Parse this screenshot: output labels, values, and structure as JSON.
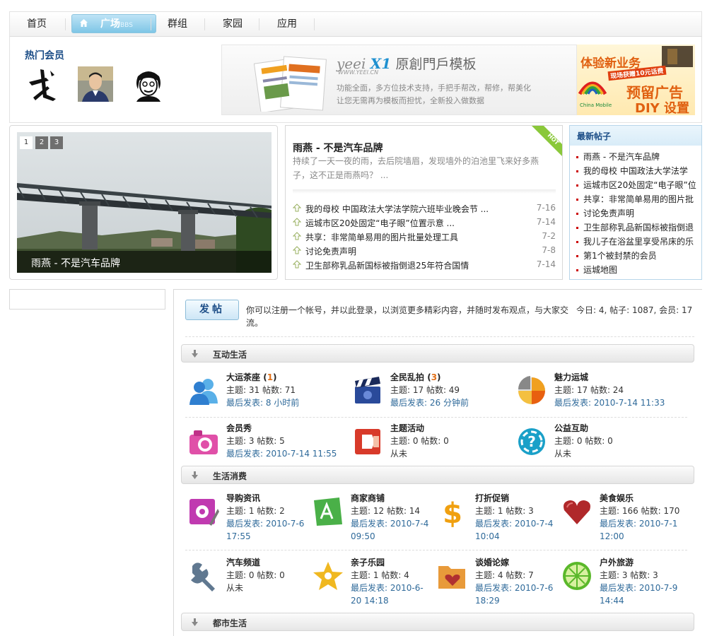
{
  "nav": {
    "home": "首页",
    "plaza": "广场",
    "plaza_sub": "BBS",
    "group": "群组",
    "home2": "家园",
    "apps": "应用"
  },
  "hot_members": {
    "title": "热门会员"
  },
  "banner1": {
    "logo_en": "yeei",
    "logo_x1": "X1",
    "logo_cn": "原創門戶模板",
    "site": "WWW.YEEI.CN",
    "line1": "功能全面，多方位技术支持，手把手帮改，帮修，帮美化",
    "line2": "让您无需再为模板而担忧，全新投入做数据"
  },
  "banner2": {
    "line1": "体验新业务",
    "line2": "现场获赠10元话费",
    "line3": "预留广告",
    "line4": "DIY 设置"
  },
  "slideshow": {
    "pages": [
      "1",
      "2",
      "3"
    ],
    "caption": "雨燕 - 不是汽车品牌"
  },
  "headline": {
    "badge": "HOT",
    "title": "雨燕 - 不是汽车品牌",
    "summary": "持续了一天一夜的雨，去后院墙眉，发现墙外的泊池里飞来好多燕子，这不正是雨燕吗？ ..."
  },
  "news": [
    {
      "title": "我的母校 中国政法大学法学院六班毕业晚会节 ...",
      "date": "7-16"
    },
    {
      "title": "运城市区20处固定“电子眼”位置示意 ...",
      "date": "7-14"
    },
    {
      "title": "共享：非常简单易用的图片批量处理工具",
      "date": "7-2"
    },
    {
      "title": "讨论免责声明",
      "date": "7-8"
    },
    {
      "title": "卫生部称乳品新国标被指倒退25年符合国情",
      "date": "7-14"
    }
  ],
  "latest": {
    "title": "最新帖子",
    "items": [
      "雨燕 - 不是汽车品牌",
      "我的母校 中国政法大学法学",
      "运城市区20处固定“电子眼”位",
      "共享：非常简单易用的图片批",
      "讨论免责声明",
      "卫生部称乳品新国标被指倒退",
      "我儿子在浴盆里享受吊床的乐",
      "第1个被封禁的会员",
      "运城地图"
    ]
  },
  "forum": {
    "post_button": "发帖",
    "welcome": "你可以注册一个帐号，并以此登录，以浏览更多精彩内容，并随时发布观点，与大家交流。",
    "stats": "今日: 4, 帖子: 1087, 会员: 17",
    "categories": [
      {
        "name": "互动生活",
        "boards": [
          {
            "name": "大运茶座",
            "today": "1",
            "stats": "主题: 31 帖数: 71",
            "last": "最后发表: 8 小时前",
            "icon": "users-icon",
            "color": "#2f8fd8"
          },
          {
            "name": "全民乱拍",
            "today": "3",
            "stats": "主题: 17 帖数: 49",
            "last": "最后发表: 26 分钟前",
            "icon": "clapper-icon",
            "color": "#2a4a9a"
          },
          {
            "name": "魅力运城",
            "today": "",
            "stats": "主题: 17 帖数: 24",
            "last": "最后发表: 2010-7-14 11:33",
            "icon": "pie-icon",
            "color": "#f08a1c"
          },
          {
            "name": "会员秀",
            "today": "",
            "stats": "主题: 3 帖数: 5",
            "last": "最后发表: 2010-7-14 11:55",
            "icon": "camera-icon",
            "color": "#e0409a"
          },
          {
            "name": "主题活动",
            "today": "",
            "stats": "主题: 0 帖数: 0",
            "last": "从未",
            "icon": "activity-icon",
            "color": "#d83a2a"
          },
          {
            "name": "公益互助",
            "today": "",
            "stats": "主题: 0 帖数: 0",
            "last": "从未",
            "icon": "help-icon",
            "color": "#1aa0c8"
          }
        ]
      },
      {
        "name": "生活消费",
        "boards": [
          {
            "name": "导购资讯",
            "today": "",
            "stats": "主题: 1 帖数: 2",
            "last": "最后发表: 2010-7-6 17:55",
            "icon": "gear-icon",
            "color": "#c03ab0"
          },
          {
            "name": "商家商铺",
            "today": "",
            "stats": "主题: 12 帖数: 14",
            "last": "最后发表: 2010-7-4 09:50",
            "icon": "shop-icon",
            "color": "#4ab048"
          },
          {
            "name": "打折促销",
            "today": "",
            "stats": "主题: 1 帖数: 3",
            "last": "最后发表: 2010-7-4 10:04",
            "icon": "dollar-icon",
            "color": "#f0a010"
          },
          {
            "name": "美食娱乐",
            "today": "",
            "stats": "主题: 166 帖数: 170",
            "last": "最后发表: 2010-7-1 12:00",
            "icon": "heart-icon",
            "color": "#b0282a"
          },
          {
            "name": "汽车频道",
            "today": "",
            "stats": "主题: 0 帖数: 0",
            "last": "从未",
            "icon": "wrench-icon",
            "color": "#607890"
          },
          {
            "name": "亲子乐园",
            "today": "",
            "stats": "主题: 1 帖数: 4",
            "last": "最后发表: 2010-6-20 14:18",
            "icon": "star-icon",
            "color": "#f0b820"
          },
          {
            "name": "谈婚论嫁",
            "today": "",
            "stats": "主题: 4 帖数: 7",
            "last": "最后发表: 2010-7-6 18:29",
            "icon": "folder-heart-icon",
            "color": "#e89a3a"
          },
          {
            "name": "户外旅游",
            "today": "",
            "stats": "主题: 3 帖数: 3",
            "last": "最后发表: 2010-7-9 14:44",
            "icon": "lime-icon",
            "color": "#5ab82a"
          }
        ]
      },
      {
        "name": "都市生活",
        "boards": []
      }
    ]
  }
}
